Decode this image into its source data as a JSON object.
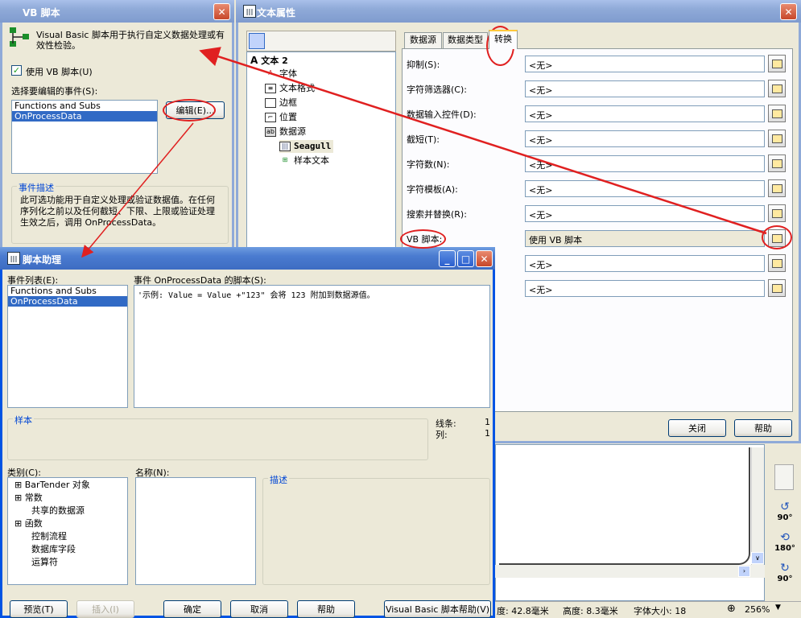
{
  "vb_window": {
    "title": "VB 脚本",
    "description": "Visual Basic 脚本用于执行自定义数据处理或有效性检验。",
    "use_vb_checkbox": "使用 VB 脚本(U)",
    "events_label": "选择要编辑的事件(S):",
    "events": [
      "Functions and Subs",
      "OnProcessData"
    ],
    "edit_button": "编辑(E)...",
    "event_desc_title": "事件描述",
    "event_desc_text": "此可选功能用于自定义处理或验证数据值。在任何序列化之前以及任何截短、下限、上限或验证处理生效之后，调用 OnProcessData。"
  },
  "props_window": {
    "title": "文本属性",
    "tree": [
      "文本 2",
      "字体",
      "文本格式",
      "边框",
      "位置",
      "数据源",
      "Seagull",
      "样本文本"
    ],
    "tabs": [
      "数据源",
      "数据类型",
      "转换"
    ],
    "rows": [
      {
        "label": "抑制(S):",
        "value": "<无>"
      },
      {
        "label": "字符筛选器(C):",
        "value": "<无>"
      },
      {
        "label": "数据输入控件(D):",
        "value": "<无>"
      },
      {
        "label": "截短(T):",
        "value": "<无>"
      },
      {
        "label": "字符数(N):",
        "value": "<无>"
      },
      {
        "label": "字符模板(A):",
        "value": "<无>"
      },
      {
        "label": "搜索并替换(R):",
        "value": "<无>"
      },
      {
        "label": "VB 脚本:",
        "value": "使用 VB 脚本"
      },
      {
        "label": "",
        "value": "<无>"
      },
      {
        "label": "",
        "value": "<无>"
      }
    ],
    "close_button": "关闭",
    "help_button": "帮助"
  },
  "helper_window": {
    "title": "脚本助理",
    "event_list_label": "事件列表(E):",
    "events": [
      "Functions and Subs",
      "OnProcessData"
    ],
    "script_label": "事件 OnProcessData 的脚本(S):",
    "script_text": "'示例: Value = Value +\"123\" 会将 123 附加到数据源值。",
    "sample_label": "样本",
    "line_label": "线条:",
    "line_value": "1",
    "col_label": "列:",
    "col_value": "1",
    "category_label": "类别(C):",
    "categories": [
      "BarTender 对象",
      "常数",
      "共享的数据源",
      "函数",
      "控制流程",
      "数据库字段",
      "运算符"
    ],
    "name_label": "名称(N):",
    "desc_label": "描述",
    "buttons": {
      "preview": "预览(T)",
      "insert": "插入(I)",
      "ok": "确定",
      "cancel": "取消",
      "help": "帮助",
      "vb_help": "Visual Basic 脚本帮助(V)"
    }
  },
  "statusbar": {
    "width": "度: 42.8毫米",
    "height": "高度: 8.3毫米",
    "font_size": "字体大小: 18",
    "zoom": "256%"
  },
  "rotate": {
    "r1": "90°",
    "r2": "180°",
    "r3": "90°"
  },
  "colors": {
    "accent": "#316ac5",
    "annotation": "#e02020",
    "title_active": "#3d6cc2"
  }
}
